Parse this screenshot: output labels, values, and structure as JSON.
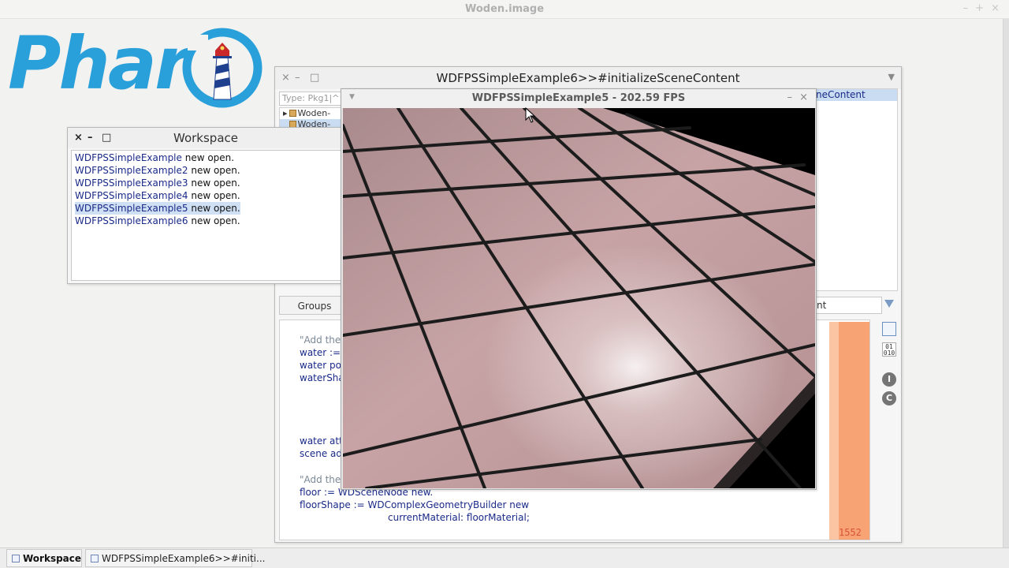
{
  "os_window": {
    "title": "Woden.image",
    "minimize": "–",
    "maximize": "+",
    "close": "×"
  },
  "logo": {
    "text": "Phar"
  },
  "browser": {
    "title": "WDFPSSimpleExample6>>#initializeSceneContent",
    "close": "×",
    "minimize": "–",
    "maximize": "□",
    "menu": "▼",
    "package_search_placeholder": "Type: Pkg1|^",
    "packages": [
      "Woden-",
      "Woden-"
    ],
    "selected_method_fragment": "neContent",
    "groups_label": "Groups",
    "filter_value": "nt",
    "line_count": "1552",
    "tools": {
      "bin": "01\n010",
      "info": "I",
      "classic": "C"
    },
    "code_lines": [
      "\"Add the",
      "water :=",
      "water po",
      "waterSha",
      "water att",
      "scene ad",
      "\"Add the",
      "floor := WDSceneNode new.",
      "floorShape := WDComplexGeometryBuilder new",
      "currentMaterial: floorMaterial;"
    ]
  },
  "workspace": {
    "title": "Workspace",
    "close": "×",
    "minimize": "–",
    "maximize": "□",
    "lines": [
      {
        "cls": "WDFPSSimpleExample",
        "msg": " new open."
      },
      {
        "cls": "WDFPSSimpleExample2",
        "msg": " new open."
      },
      {
        "cls": "WDFPSSimpleExample3",
        "msg": " new open."
      },
      {
        "cls": "WDFPSSimpleExample4",
        "msg": " new open."
      },
      {
        "cls": "WDFPSSimpleExample5",
        "msg": " new open."
      },
      {
        "cls": "WDFPSSimpleExample6",
        "msg": " new open."
      }
    ]
  },
  "render_window": {
    "title": "WDFPSSimpleExample5 - 202.59 FPS",
    "menu": "▼",
    "minimize": "–",
    "close": "×"
  },
  "taskbar": {
    "workspace": "Workspace",
    "browser": "WDFPSSimpleExample6>>#initi..."
  },
  "colors": {
    "logo_blue": "#2aa0da",
    "selection": "#cfe0f4",
    "tile": "#c9a3a4",
    "grout": "#1c1c1c",
    "gutter": "#f7a373",
    "code_class": "#1a2a88"
  }
}
